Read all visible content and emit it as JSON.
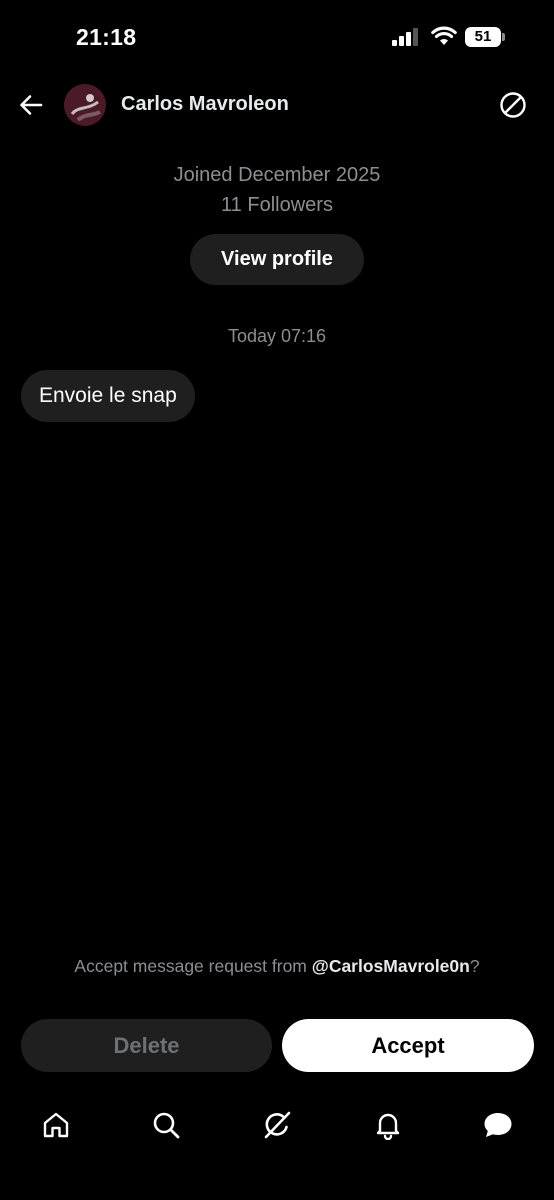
{
  "status_bar": {
    "time": "21:18",
    "battery_level": "51",
    "icons": [
      "cellular-signal-icon",
      "wifi-icon",
      "battery-icon"
    ]
  },
  "header": {
    "name": "Carlos Mavroleon",
    "back_icon": "back-arrow-icon",
    "block_icon": "block-icon"
  },
  "profile": {
    "joined": "Joined December 2025",
    "followers": "11 Followers",
    "view_profile_label": "View profile"
  },
  "conversation": {
    "timestamp": "Today 07:16",
    "messages": [
      {
        "text": "Envoie le snap"
      }
    ]
  },
  "request": {
    "prefix": "Accept message request from ",
    "handle": "@CarlosMavrole0n",
    "suffix": "?",
    "delete_label": "Delete",
    "accept_label": "Accept"
  },
  "bottom_nav": {
    "items": [
      "home-icon",
      "search-icon",
      "grok-icon",
      "notifications-icon",
      "messages-icon"
    ]
  },
  "colors": {
    "background": "#000000",
    "bubble": "#1f1f1f",
    "muted_text": "#8b8f93",
    "primary_text": "#e7e9ea",
    "accept_bg": "#ffffff"
  }
}
